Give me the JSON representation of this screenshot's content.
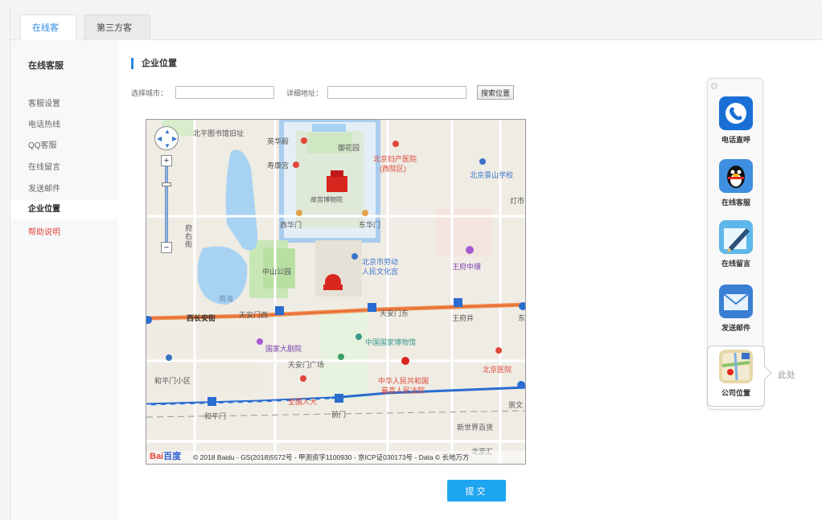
{
  "tabs": [
    {
      "label": "在线客服"
    },
    {
      "label": "第三方客服"
    }
  ],
  "sidebar": {
    "heading": "在线客服",
    "items": [
      {
        "label": "客服设置"
      },
      {
        "label": "电话热线"
      },
      {
        "label": "QQ客服"
      },
      {
        "label": "在线留言"
      },
      {
        "label": "发送邮件"
      },
      {
        "label": "企业位置"
      },
      {
        "label": "帮助说明"
      }
    ]
  },
  "main": {
    "section_title": "企业位置",
    "city_label": "选择城市：",
    "city_value": "",
    "address_label": "详细地址：",
    "address_value": "",
    "search_button": "搜索位置",
    "submit_button": "提交"
  },
  "map": {
    "labels": {
      "l1": "北平图书馆旧址",
      "l2": "英华殿",
      "l3": "御花园",
      "l4": "寿康宫",
      "l5": "北京妇产医院",
      "l6": "(西院区)",
      "l7": "北京景山学校",
      "l8": "故宫博物院",
      "l9": "西华门",
      "l10": "东华门",
      "l11": "灯市",
      "l12": "府右街",
      "l13": "北京市劳动",
      "l14": "人民文化宫",
      "l15": "王府中環",
      "l16": "中山公园",
      "l17": "南海",
      "l18": "西长安街",
      "l19": "天安门西",
      "l20": "天安门东",
      "l21": "王府井",
      "l22": "国家大剧院",
      "l23": "中国国家博物馆",
      "l24": "天安门广场",
      "l25": "和平门小区",
      "l26": "中华人民共和国",
      "l27": "最高人民法院",
      "l28": "北京医院",
      "l29": "和平门",
      "l30": "前门",
      "l31": "崇文",
      "l32": "新世界百货",
      "l33": "北京汇",
      "l34": "全国人大",
      "l35": "东"
    },
    "copyright": "© 2018 Baidu - GS(2018)5572号 - 甲测资字1100930 - 京ICP证030173号 - Data © 长地万方",
    "logo_text": "Bai",
    "logo_suffix": "百度"
  },
  "float_panel": {
    "items": [
      {
        "label": "电话直呼",
        "icon": "skype-phone-icon"
      },
      {
        "label": "在线客服",
        "icon": "qq-penguin-icon"
      },
      {
        "label": "在线留言",
        "icon": "pen-note-icon"
      },
      {
        "label": "发送邮件",
        "icon": "mail-envelope-icon"
      },
      {
        "label": "公司位置",
        "icon": "map-pin-icon"
      }
    ],
    "here_label": "此处"
  },
  "colors": {
    "accent": "#2a8ae0",
    "submit": "#1ea5f0",
    "danger": "#e0473a"
  }
}
